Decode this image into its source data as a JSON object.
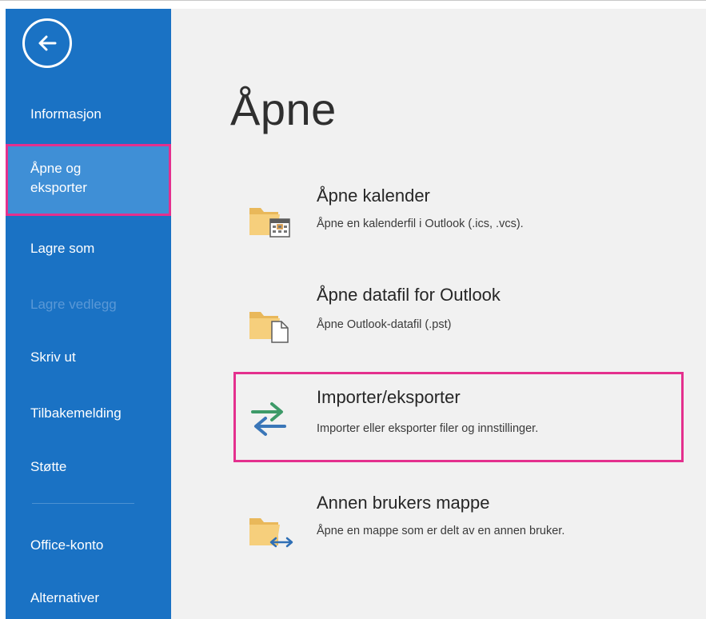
{
  "sidebar": {
    "back_label": "Back",
    "items": [
      {
        "label": "Informasjon"
      },
      {
        "label": "Åpne og\neksporter"
      },
      {
        "label": "Lagre som"
      },
      {
        "label": "Lagre vedlegg"
      },
      {
        "label": "Skriv ut"
      },
      {
        "label": "Tilbakemelding"
      },
      {
        "label": "Støtte"
      },
      {
        "label": "Office-konto"
      },
      {
        "label": "Alternativer"
      }
    ]
  },
  "main": {
    "title": "Åpne",
    "options": [
      {
        "title": "Åpne kalender",
        "description": "Åpne en kalenderfil i Outlook (.ics, .vcs).",
        "icon": "folder-calendar-icon"
      },
      {
        "title": "Åpne datafil for Outlook",
        "description": "Åpne Outlook-datafil (.pst)",
        "icon": "folder-file-icon"
      },
      {
        "title": "Importer/eksporter",
        "description": "Importer eller eksporter filer og innstillinger.",
        "icon": "import-export-arrows-icon"
      },
      {
        "title": "Annen brukers mappe",
        "description": "Åpne en mappe som er delt av en annen bruker.",
        "icon": "folder-shared-icon"
      }
    ]
  },
  "colors": {
    "sidebar": "#1a72c4",
    "sidebar_selected": "#3f8fd6",
    "highlight": "#e4308e",
    "main_background": "#f1f1f1"
  }
}
